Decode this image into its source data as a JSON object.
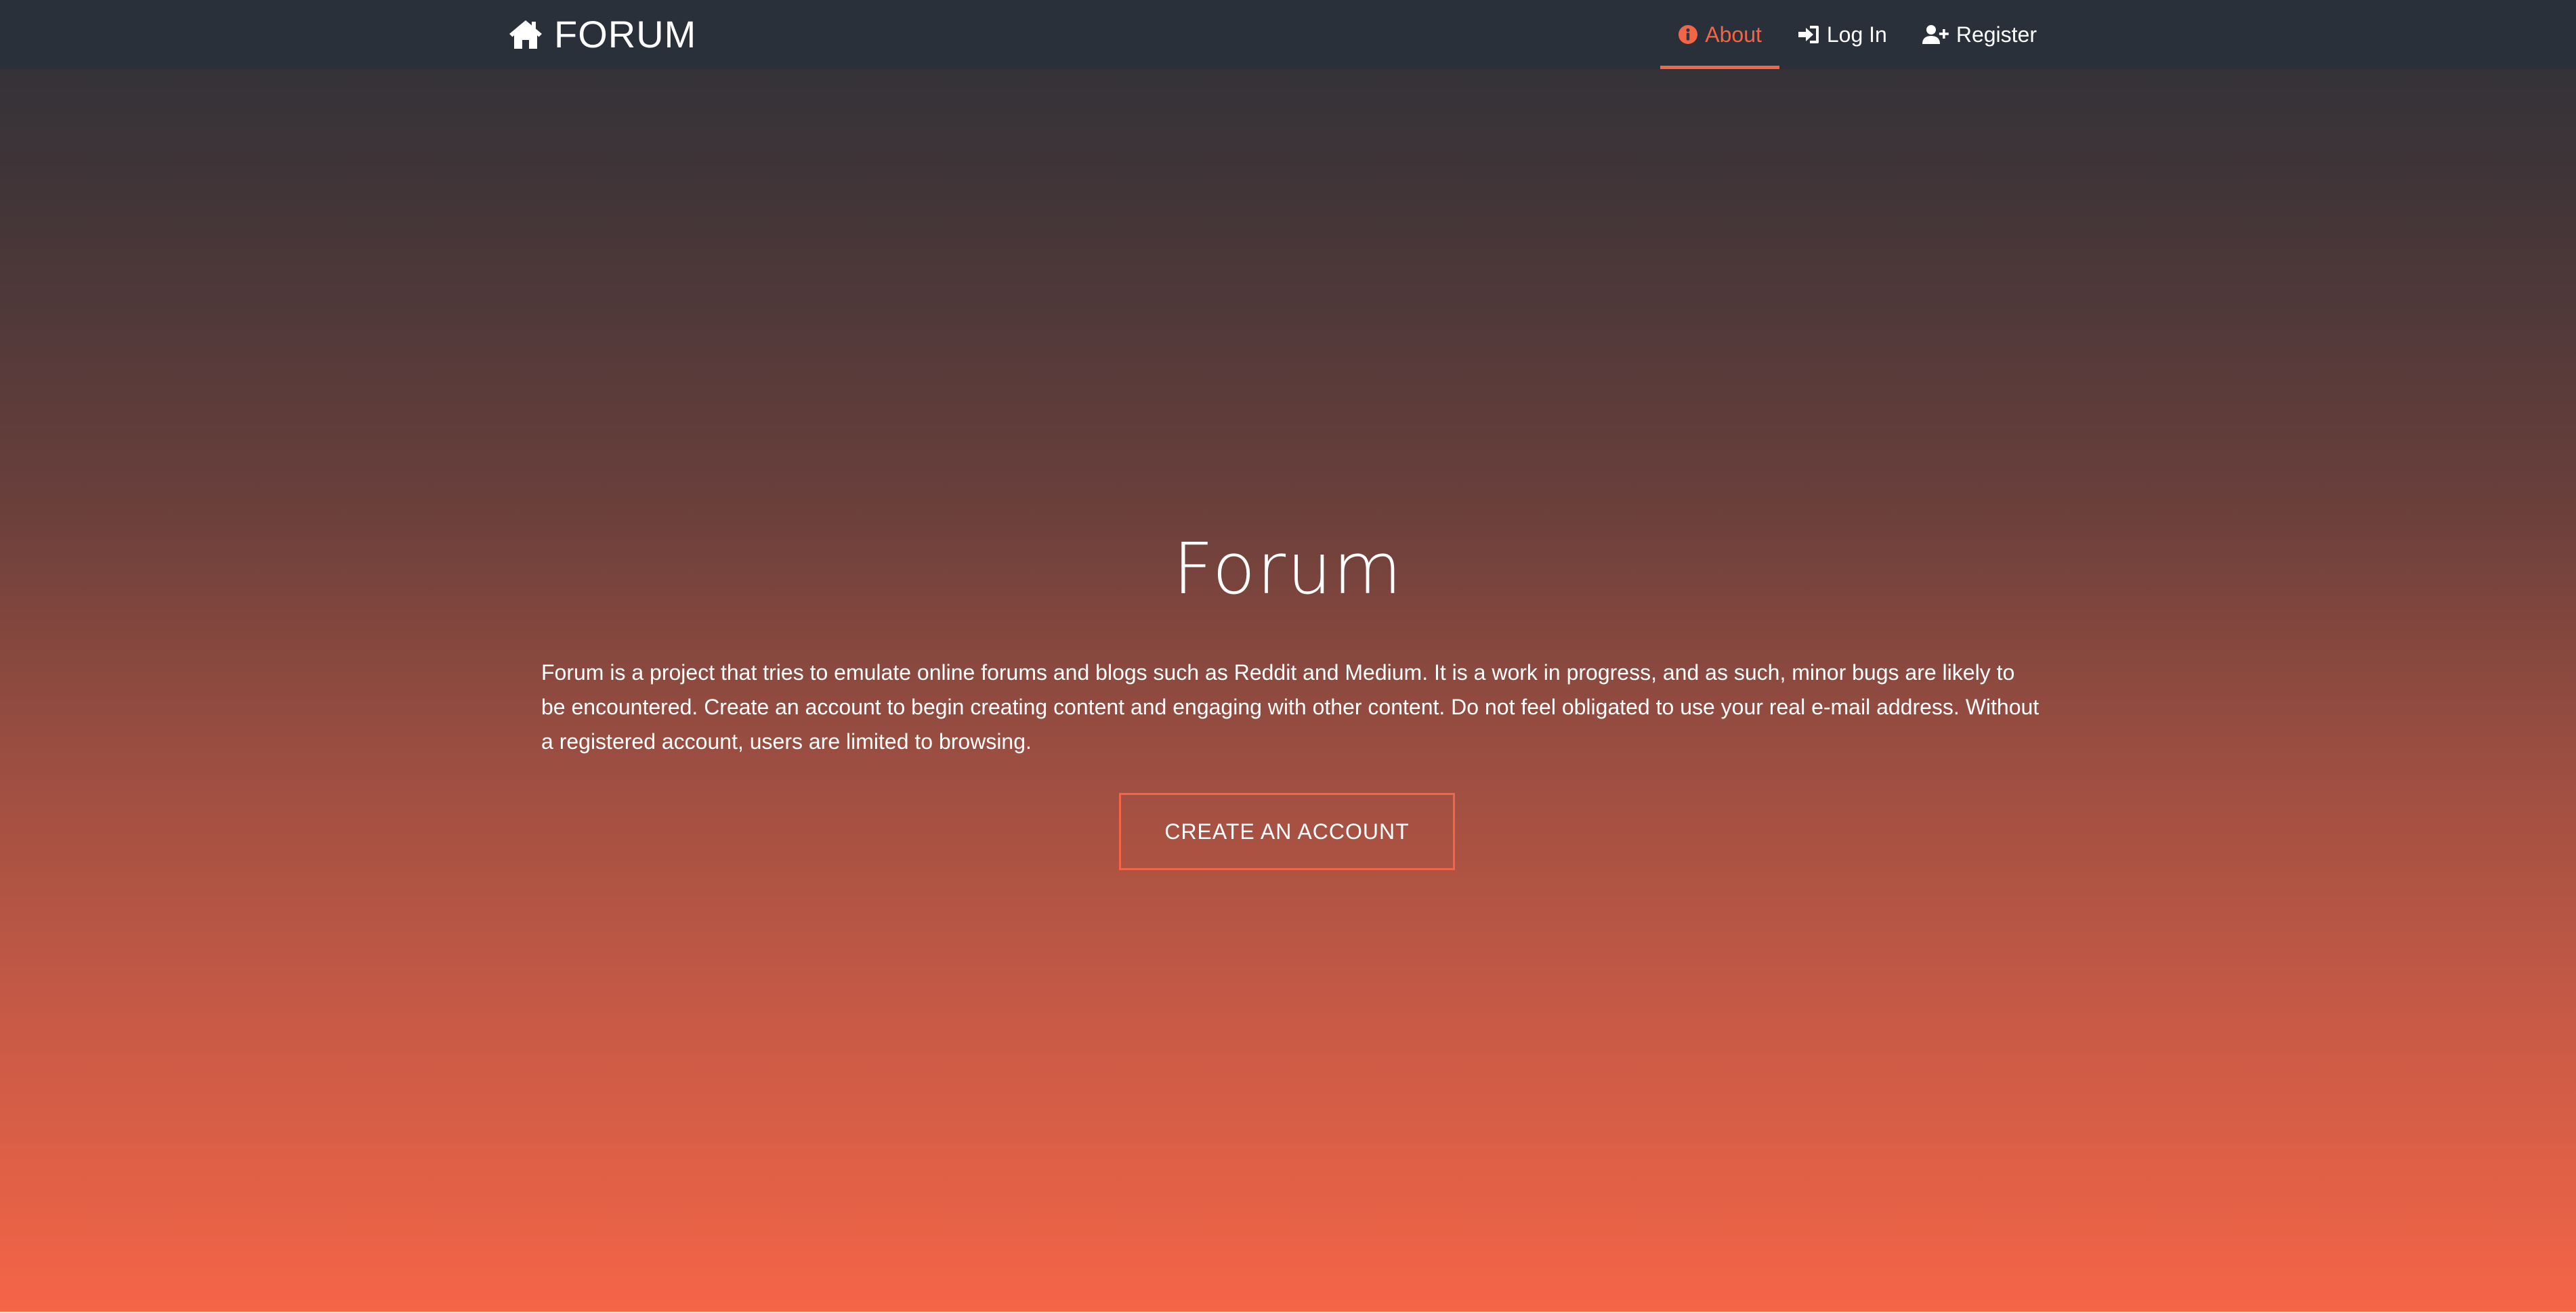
{
  "navbar": {
    "brand": "FORUM",
    "items": [
      {
        "label": "About",
        "icon": "info-circle-icon",
        "active": true
      },
      {
        "label": "Log In",
        "icon": "sign-in-icon",
        "active": false
      },
      {
        "label": "Register",
        "icon": "user-plus-icon",
        "active": false
      }
    ]
  },
  "hero": {
    "title": "Forum",
    "description": "Forum is a project that tries to emulate online forums and blogs such as Reddit and Medium. It is a work in progress, and as such, minor bugs are likely to be encountered. Create an account to begin creating content and engaging with other content. Do not feel obligated to use your real e-mail address. Without a registered account, users are limited to browsing.",
    "cta_label": "CREATE AN ACCOUNT"
  },
  "colors": {
    "navbar_bg": "#29303a",
    "accent": "#f26546",
    "gradient_top": "#2d3138",
    "gradient_bottom": "#f56547",
    "text": "#ffffff"
  }
}
